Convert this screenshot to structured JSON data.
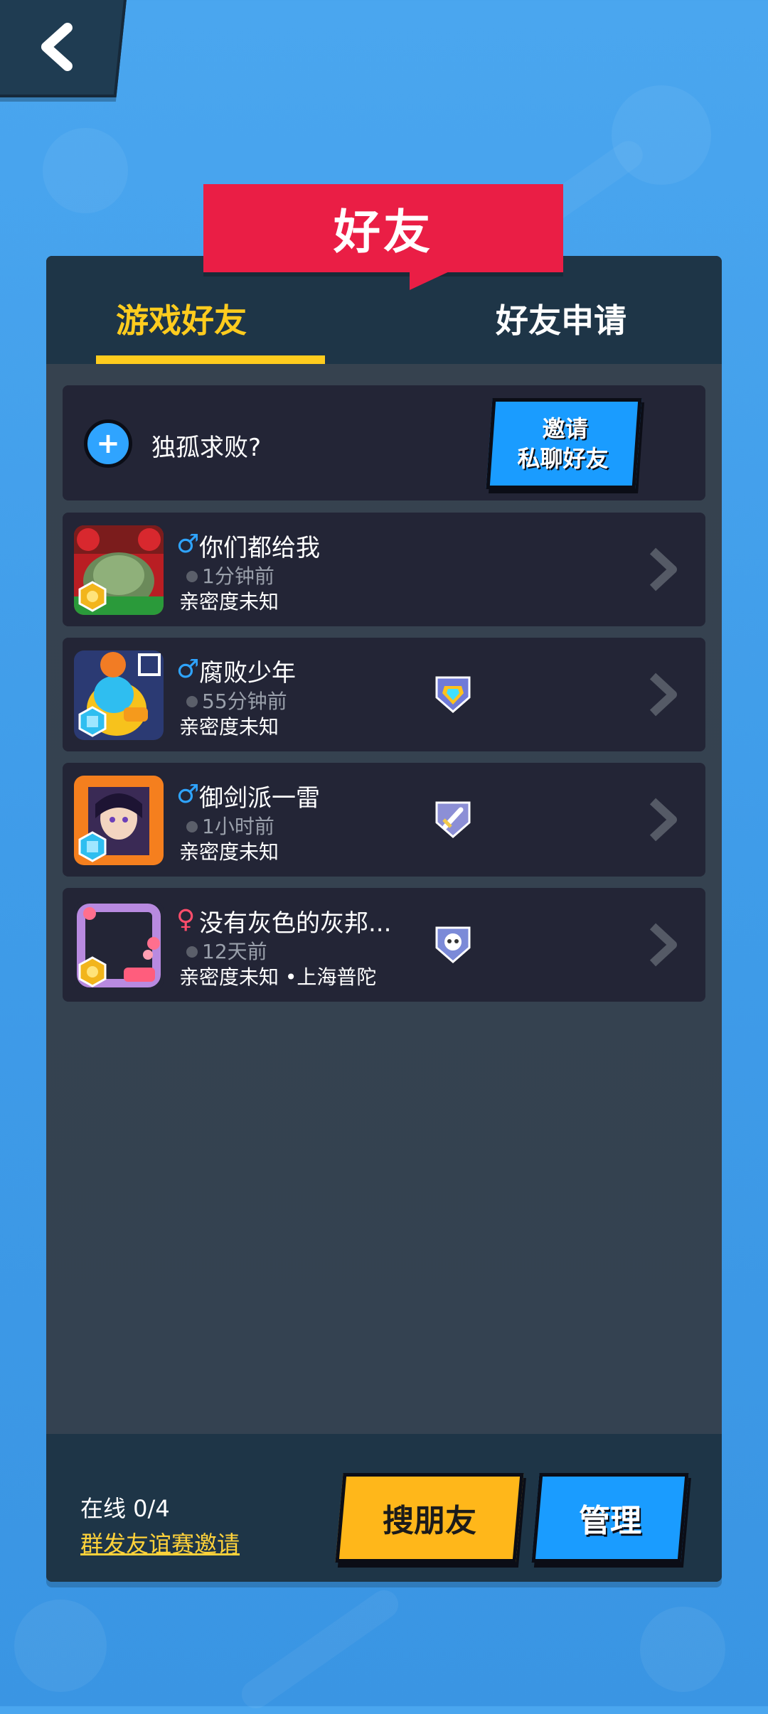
{
  "header": {
    "title": "好友"
  },
  "tabs": [
    {
      "label": "游戏好友",
      "active": true
    },
    {
      "label": "好友申请",
      "active": false
    }
  ],
  "invite_card": {
    "prompt": "独孤求败?",
    "button_line1": "邀请",
    "button_line2": "私聊好友"
  },
  "friends": [
    {
      "gender": "♂",
      "name": "你们都给我",
      "last_online": "1分钟前",
      "intimacy": "亲密度未知",
      "avatar_icon": "character-avatar-icon",
      "rank_icon": null
    },
    {
      "gender": "♂",
      "name": "腐败少年",
      "last_online": "55分钟前",
      "intimacy": "亲密度未知",
      "avatar_icon": "duck-avatar-icon",
      "rank_icon": "gem-shield-icon"
    },
    {
      "gender": "♂",
      "name": "御剑派一雷",
      "last_online": "1小时前",
      "intimacy": "亲密度未知",
      "avatar_icon": "anime-avatar-icon",
      "rank_icon": "sword-shield-icon"
    },
    {
      "gender": "♀",
      "name": "没有灰色的灰邦...",
      "last_online": "12天前",
      "intimacy": "亲密度未知 •上海普陀",
      "avatar_icon": "heart-frame-avatar-icon",
      "rank_icon": "skull-shield-icon"
    }
  ],
  "footer": {
    "online_count": "在线 0/4",
    "batch_invite": "群发友谊赛邀请",
    "search_label": "搜朋友",
    "manage_label": "管理"
  },
  "colors": {
    "background": "#3f9ce9",
    "panel": "#2f3e50",
    "accent_yellow": "#ffcc1e",
    "title_red": "#ea1e45",
    "button_blue": "#1a9cff",
    "button_orange": "#ffb71a"
  }
}
